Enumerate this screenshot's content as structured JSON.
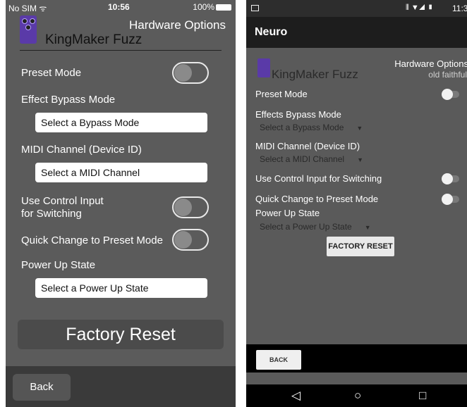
{
  "ios": {
    "status": {
      "carrier": "No SIM",
      "time": "10:56",
      "battery": "100%"
    },
    "header": {
      "options_title": "Hardware Options",
      "app_title": "KingMaker Fuzz"
    },
    "preset_mode": {
      "label": "Preset Mode",
      "on": false
    },
    "bypass": {
      "label": "Effect Bypass Mode",
      "value": "Select a Bypass Mode"
    },
    "midi": {
      "label": "MIDI Channel (Device ID)",
      "value": "Select a MIDI Channel"
    },
    "control_input": {
      "label_line1": "Use Control Input",
      "label_line2": "for Switching",
      "on": false
    },
    "quick_change": {
      "label": "Quick Change to Preset Mode",
      "on": false
    },
    "power_up": {
      "label": "Power Up State",
      "value": "Select a Power Up State"
    },
    "factory_reset": "Factory Reset",
    "back": "Back"
  },
  "android": {
    "status": {
      "time": "11:3"
    },
    "app_title": "Neuro",
    "header": {
      "options_title": "Hardware Options",
      "preset_name": "old faithful",
      "brand": "KingMaker Fuzz"
    },
    "preset_mode": {
      "label": "Preset Mode",
      "on": false
    },
    "bypass": {
      "label": "Effects Bypass Mode",
      "value": "Select a Bypass Mode"
    },
    "midi": {
      "label": "MIDI Channel (Device ID)",
      "value": "Select a MIDI Channel"
    },
    "control_input": {
      "label": "Use Control Input for Switching",
      "on": false
    },
    "quick_change": {
      "label": "Quick Change to Preset Mode",
      "on": false
    },
    "power_up": {
      "label": "Power Up State",
      "value": "Select a Power Up State"
    },
    "factory_reset": "FACTORY RESET",
    "back": "BACK",
    "nav_icons": [
      "back-triangle-icon",
      "home-circle-icon",
      "recents-square-icon"
    ]
  }
}
